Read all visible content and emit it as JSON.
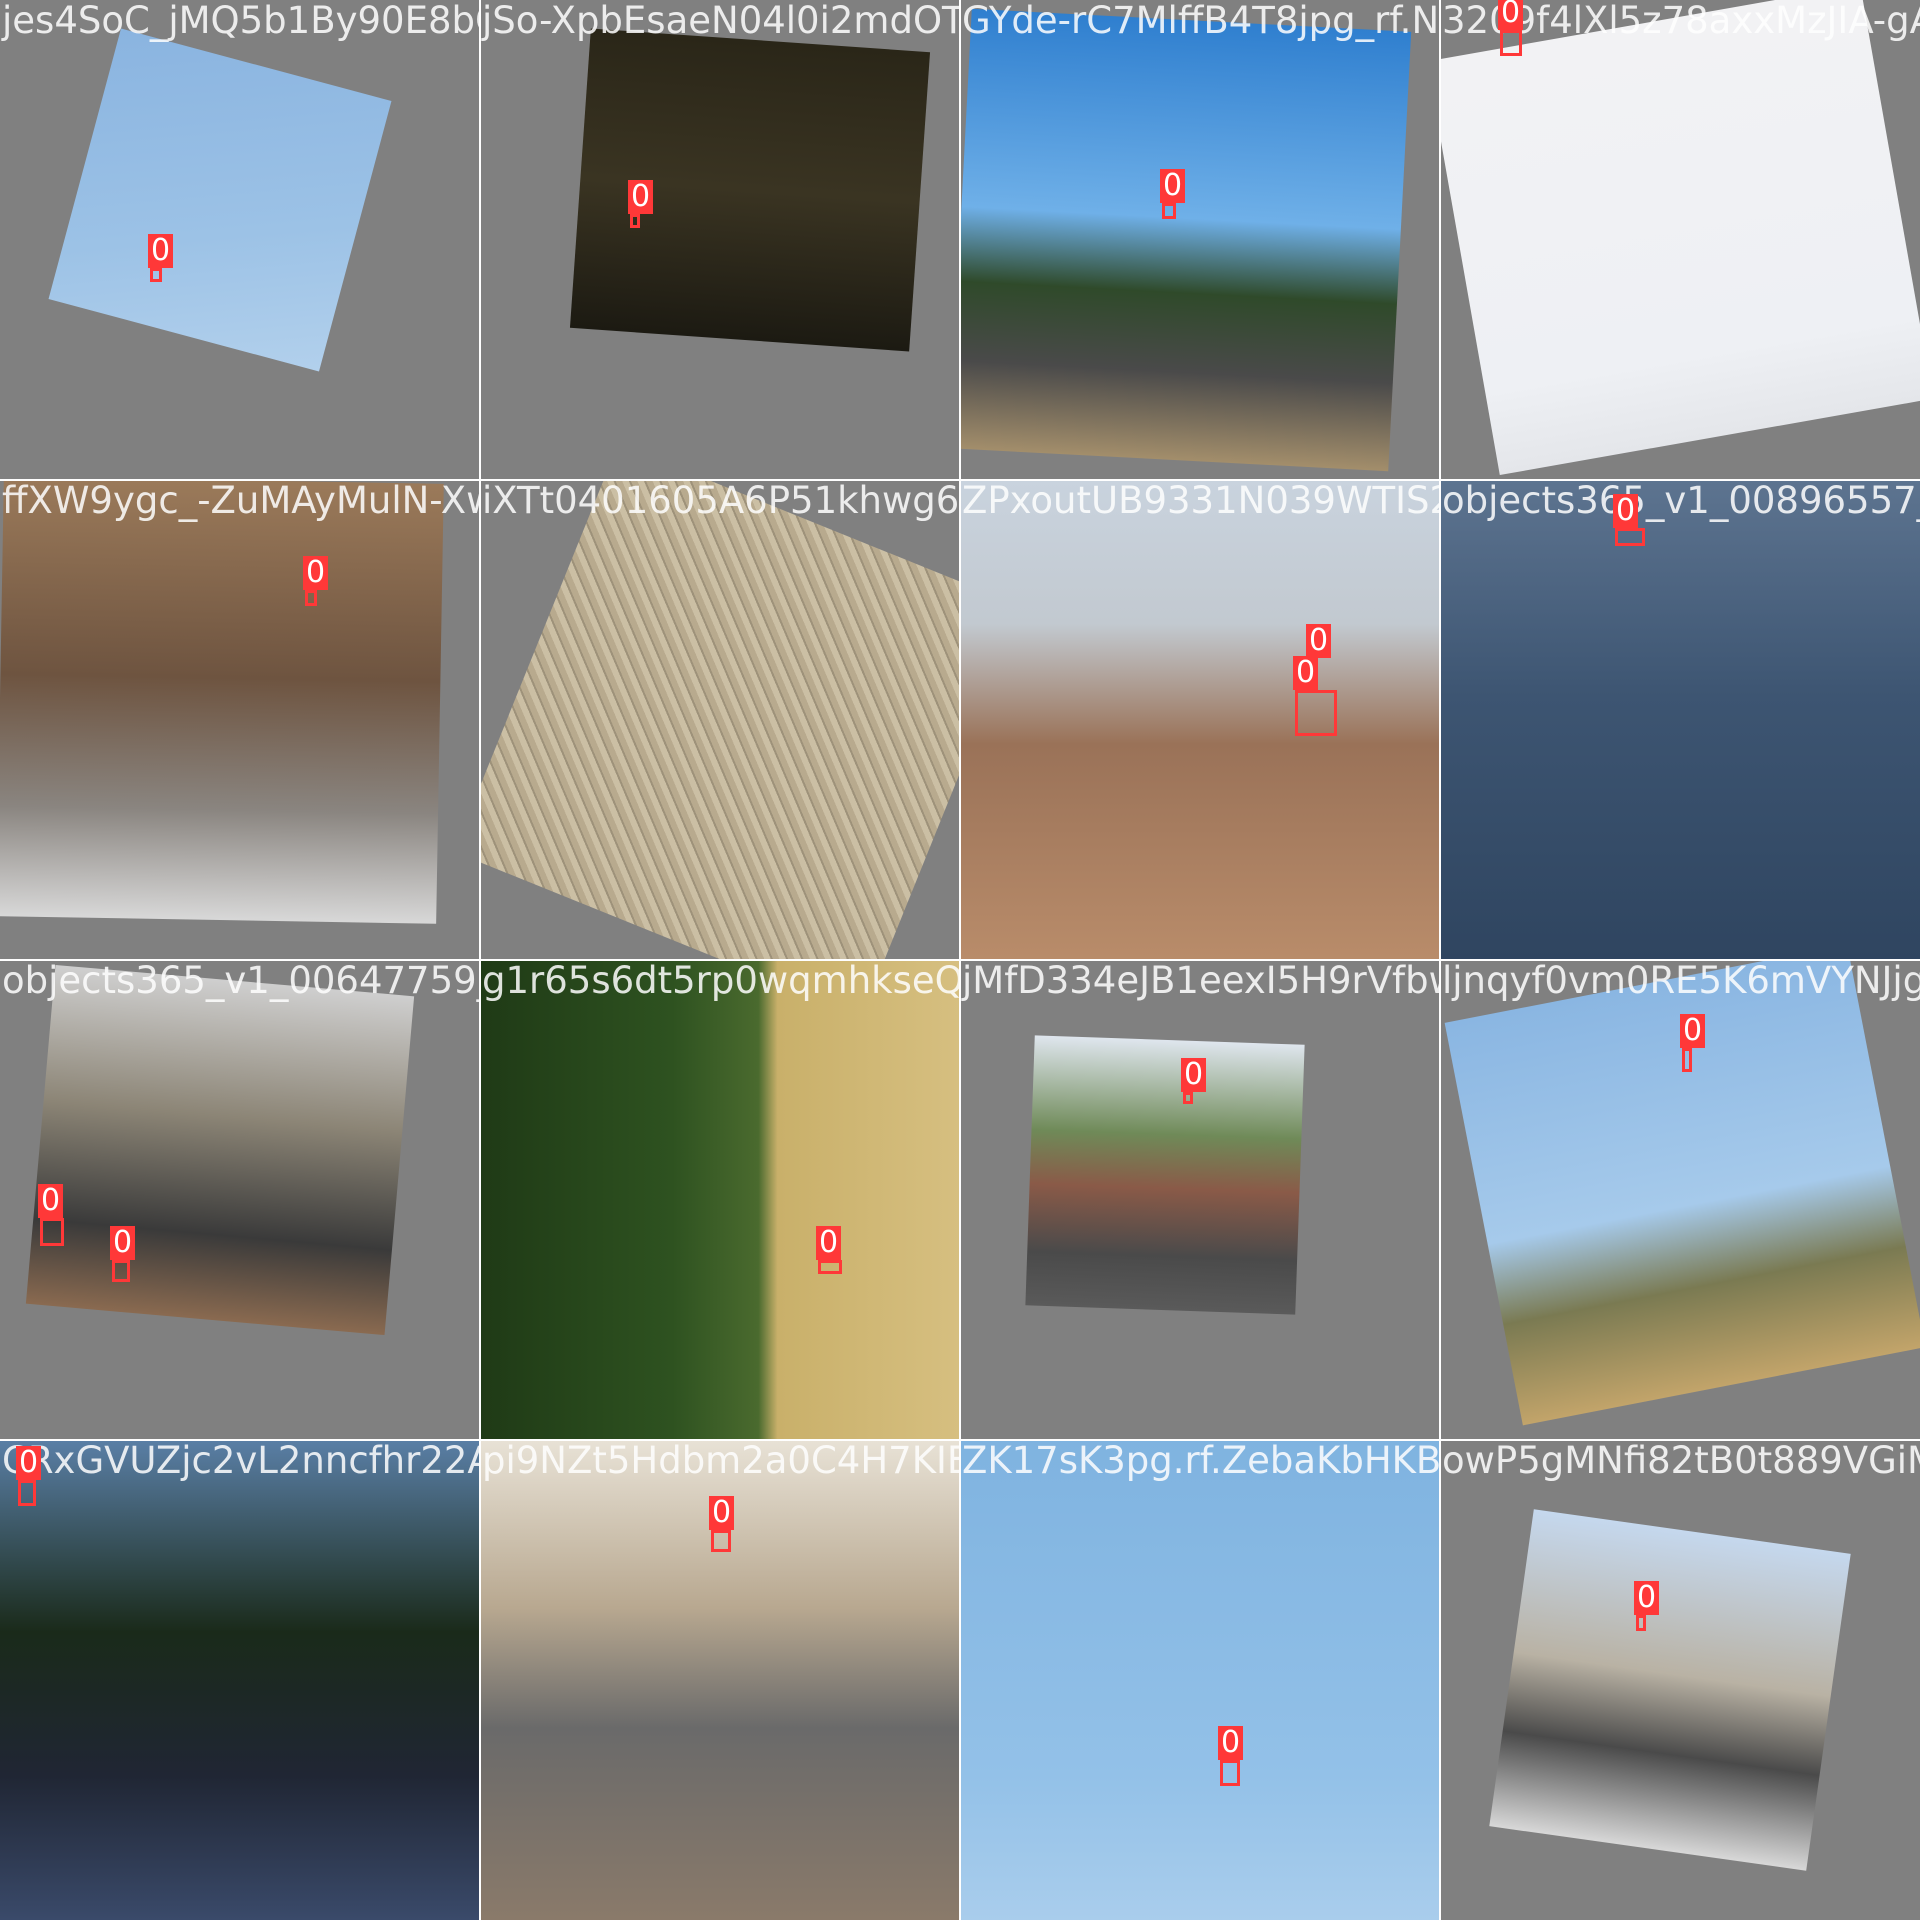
{
  "mosaic": {
    "background_color": "#808080",
    "box_color": "#ff3838",
    "tiles": [
      {
        "filename": "jes4SoC_jMQ5b1By90E8bQ_jpg.rf.bE555N04l0Si2mdOTO",
        "scene": "sky",
        "annotations": [
          {
            "label": "0"
          }
        ]
      },
      {
        "filename": "jSo-XpbEsaeN04l0i2mdOTO_jpg.rf.G...",
        "scene": "night-street",
        "annotations": [
          {
            "label": "0"
          }
        ]
      },
      {
        "filename": "GYde-rC7MlffB4T8jpg_rf.N1vqecA_320f4l",
        "scene": "traffic-lights-street",
        "annotations": [
          {
            "label": "0"
          }
        ]
      },
      {
        "filename": "3209f4lXl5z78axxMzJIA-gA_",
        "scene": "pole-sky",
        "annotations": [
          {
            "label": "0"
          }
        ]
      },
      {
        "filename": "ffXW9ygc_-ZuMAyMulN-Xw_jpg.rf.0",
        "scene": "city-street-snow",
        "annotations": [
          {
            "label": "0"
          }
        ]
      },
      {
        "filename": "iXTt0401605A6P51khwg6iAZjpg.rf.6",
        "scene": "cobblestone",
        "annotations": []
      },
      {
        "filename": "ZPxoutUB9331N039WTIS2Kw_jpg.rf.3",
        "scene": "building",
        "annotations": [
          {
            "label": "0"
          },
          {
            "label": "0"
          }
        ]
      },
      {
        "filename": "objects365_v1_00896557_jp",
        "scene": "sea-pole",
        "annotations": [
          {
            "label": "0"
          }
        ]
      },
      {
        "filename": "objects365_v1_00647759_jpg.rf.6f563d53750",
        "scene": "overpass",
        "annotations": [
          {
            "label": "0"
          },
          {
            "label": "0"
          }
        ]
      },
      {
        "filename": "g1r65s6dt5rp0wqmhkseQ_jpg.rf.0",
        "scene": "tree-wall",
        "annotations": [
          {
            "label": "0"
          }
        ]
      },
      {
        "filename": "jMfD334eJB1eexI5H9rVfbw_jpg.rf.0",
        "scene": "pink-car-street",
        "annotations": [
          {
            "label": "0"
          }
        ]
      },
      {
        "filename": "ljnqyf0vm0RE5K6mVYNJjg_",
        "scene": "utility-poles",
        "annotations": [
          {
            "label": "0"
          }
        ]
      },
      {
        "filename": "CRxGVUZjc2vL2nncfhr22A_jpg.rf.5",
        "scene": "traffic-jam",
        "annotations": [
          {
            "label": "0"
          }
        ]
      },
      {
        "filename": "pi9NZt5Hdbm2a0C4H7KIE0A_jpg.rf.1",
        "scene": "shopping-street",
        "annotations": [
          {
            "label": "0"
          }
        ]
      },
      {
        "filename": "ZK17sK3pg.rf.ZebaKbHKBAg6cw_jpg.rf.6",
        "scene": "blue-sky-lamp",
        "annotations": [
          {
            "label": "0"
          }
        ]
      },
      {
        "filename": "owP5gMNfi82tB0t889VGiMDC",
        "scene": "minivan-trees",
        "annotations": [
          {
            "label": "0"
          }
        ]
      }
    ]
  }
}
